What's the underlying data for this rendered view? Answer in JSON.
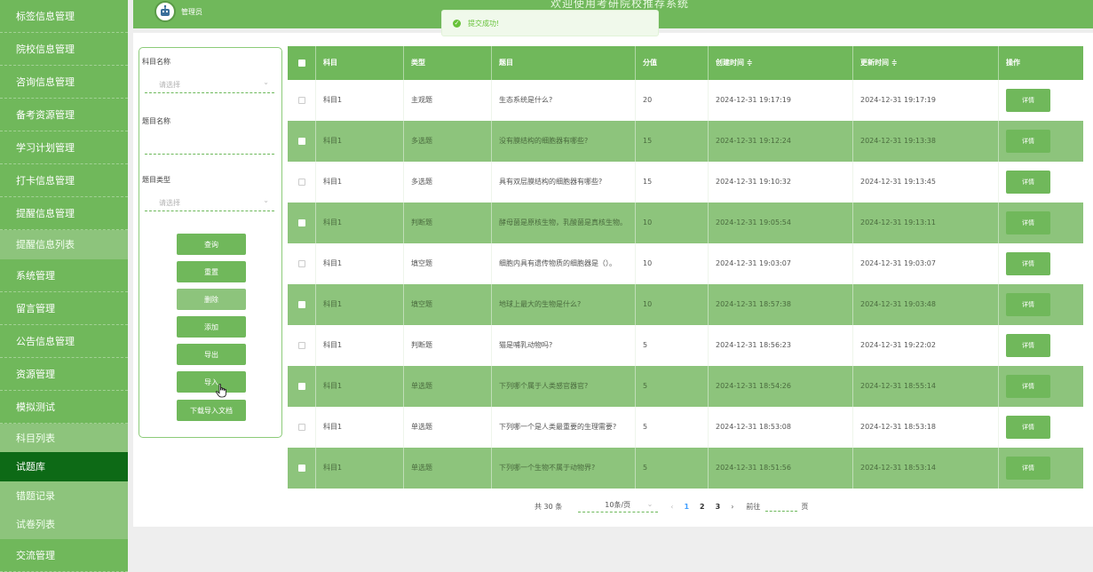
{
  "app": {
    "title": "欢迎使用考研院校推荐系统",
    "user": "管理员"
  },
  "toast": {
    "text": "提交成功!"
  },
  "sidebar": {
    "items": [
      {
        "label": "标签信息管理"
      },
      {
        "label": "院校信息管理"
      },
      {
        "label": "咨询信息管理"
      },
      {
        "label": "备考资源管理"
      },
      {
        "label": "学习计划管理"
      },
      {
        "label": "打卡信息管理"
      },
      {
        "label": "提醒信息管理"
      },
      {
        "label": "提醒信息列表"
      },
      {
        "label": "系统管理"
      },
      {
        "label": "留言管理"
      },
      {
        "label": "公告信息管理"
      },
      {
        "label": "资源管理"
      },
      {
        "label": "模拟测试"
      },
      {
        "label": "科目列表"
      },
      {
        "label": "试题库"
      },
      {
        "label": "错题记录"
      },
      {
        "label": "试卷列表"
      },
      {
        "label": "交流管理"
      }
    ]
  },
  "filter": {
    "subject_label": "科目名称",
    "subject_placeholder": "请选择",
    "question_label": "题目名称",
    "type_label": "题目类型",
    "type_placeholder": "请选择",
    "buttons": {
      "query": "查询",
      "reset": "重置",
      "delete": "删除",
      "add": "添加",
      "export": "导出",
      "import": "导入",
      "download": "下载导入文档"
    }
  },
  "table": {
    "headers": [
      "科目",
      "类型",
      "题目",
      "分值",
      "创建时间 ≑",
      "更新时间 ≑",
      "操作"
    ],
    "detail_label": "详情",
    "rows": [
      {
        "subject": "科目1",
        "type": "主观题",
        "question": "生态系统是什么?",
        "score": "20",
        "created": "2024-12-31 19:17:19",
        "updated": "2024-12-31 19:17:19"
      },
      {
        "subject": "科目1",
        "type": "多选题",
        "question": "没有膜结构的细胞器有哪些?",
        "score": "15",
        "created": "2024-12-31 19:12:24",
        "updated": "2024-12-31 19:13:38"
      },
      {
        "subject": "科目1",
        "type": "多选题",
        "question": "具有双层膜结构的细胞器有哪些?",
        "score": "15",
        "created": "2024-12-31 19:10:32",
        "updated": "2024-12-31 19:13:45"
      },
      {
        "subject": "科目1",
        "type": "判断题",
        "question": "酵母菌是原核生物，乳酸菌是真核生物。",
        "score": "10",
        "created": "2024-12-31 19:05:54",
        "updated": "2024-12-31 19:13:11"
      },
      {
        "subject": "科目1",
        "type": "填空题",
        "question": "细胞内具有遗传物质的细胞器是（）。",
        "score": "10",
        "created": "2024-12-31 19:03:07",
        "updated": "2024-12-31 19:03:07"
      },
      {
        "subject": "科目1",
        "type": "填空题",
        "question": "地球上最大的生物是什么?",
        "score": "10",
        "created": "2024-12-31 18:57:38",
        "updated": "2024-12-31 19:03:48"
      },
      {
        "subject": "科目1",
        "type": "判断题",
        "question": "猫是哺乳动物吗?",
        "score": "5",
        "created": "2024-12-31 18:56:23",
        "updated": "2024-12-31 19:22:02"
      },
      {
        "subject": "科目1",
        "type": "单选题",
        "question": "下列哪个属于人类感官器官?",
        "score": "5",
        "created": "2024-12-31 18:54:26",
        "updated": "2024-12-31 18:55:14"
      },
      {
        "subject": "科目1",
        "type": "单选题",
        "question": "下列哪一个是人类最重要的生理需要?",
        "score": "5",
        "created": "2024-12-31 18:53:08",
        "updated": "2024-12-31 18:53:18"
      },
      {
        "subject": "科目1",
        "type": "单选题",
        "question": "下列哪一个生物不属于动物界?",
        "score": "5",
        "created": "2024-12-31 18:51:56",
        "updated": "2024-12-31 18:53:14"
      }
    ]
  },
  "pagination": {
    "total_text": "共 30 条",
    "page_size": "10条/页",
    "prev": "‹",
    "next": "›",
    "pages": [
      "1",
      "2",
      "3"
    ],
    "goto_label": "前往",
    "page_unit": "页"
  },
  "colors": {
    "primary": "#70b85b",
    "light": "#8dc47c",
    "active": "#0d6a16",
    "link": "#409eff"
  },
  "icons": {
    "toast": "check-circle-icon",
    "caret": "chevron-down-icon",
    "avatar": "robot-avatar-icon",
    "cursor": "hand-pointer-icon"
  }
}
